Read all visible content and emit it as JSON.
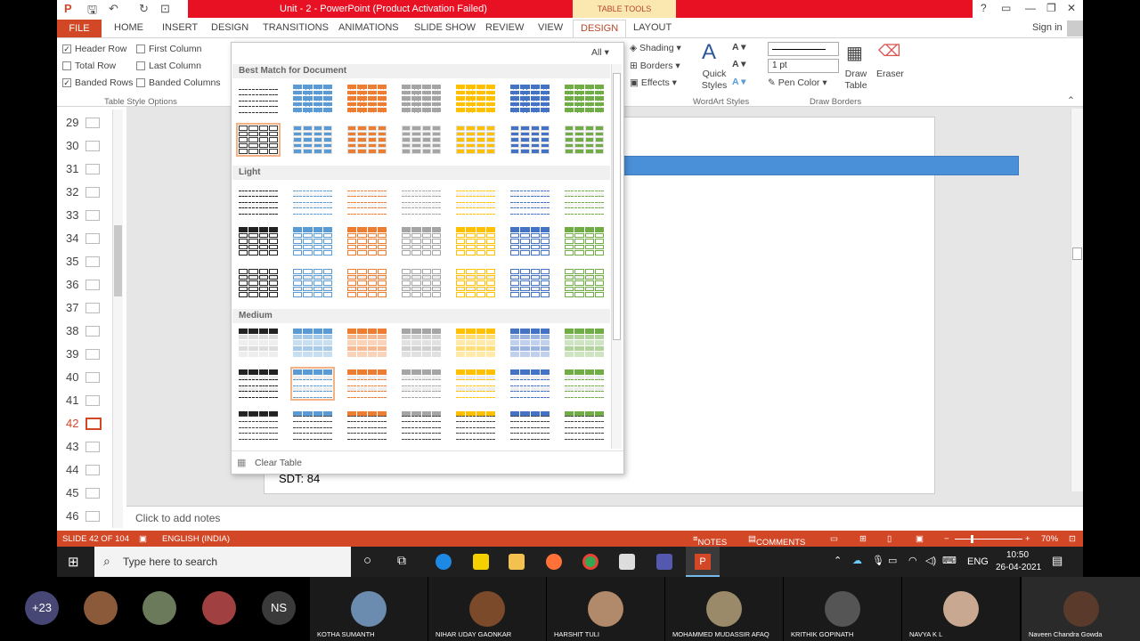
{
  "window": {
    "title": "Unit - 2 -  PowerPoint (Product Activation Failed)",
    "context_tab_group": "TABLE TOOLS",
    "sign_in": "Sign in",
    "help": "?",
    "controls": [
      "▭",
      "—",
      "❐",
      "✕"
    ]
  },
  "tabs": [
    "FILE",
    "HOME",
    "INSERT",
    "DESIGN",
    "TRANSITIONS",
    "ANIMATIONS",
    "SLIDE SHOW",
    "REVIEW",
    "VIEW",
    "DESIGN",
    "LAYOUT"
  ],
  "active_tab": "DESIGN",
  "table_style_options": {
    "header_row": "Header Row",
    "first_column": "First Column",
    "total_row": "Total Row",
    "last_column": "Last Column",
    "banded_rows": "Banded Rows",
    "banded_columns": "Banded Columns",
    "label": "Table Style Options",
    "checked": {
      "header_row": true,
      "first_column": false,
      "total_row": false,
      "last_column": false,
      "banded_rows": true,
      "banded_columns": false
    }
  },
  "ribbon": {
    "shading": "Shading",
    "borders": "Borders",
    "effects": "Effects",
    "quick_styles": "Quick Styles",
    "wordart_label": "WordArt Styles",
    "pen_weight": "1 pt",
    "pen_color": "Pen Color",
    "draw_table": "Draw Table",
    "eraser": "Eraser",
    "draw_borders_label": "Draw Borders"
  },
  "gallery": {
    "filter": "All",
    "sections": [
      "Best Match for Document",
      "Light",
      "Medium"
    ],
    "clear_table": "Clear Table",
    "colors": [
      "#7f7f7f",
      "#5b9bd5",
      "#ed7d31",
      "#a5a5a5",
      "#ffc000",
      "#4472c4",
      "#70ad47"
    ]
  },
  "slides": [
    {
      "num": "29"
    },
    {
      "num": "30"
    },
    {
      "num": "31"
    },
    {
      "num": "32"
    },
    {
      "num": "33"
    },
    {
      "num": "34"
    },
    {
      "num": "35"
    },
    {
      "num": "36"
    },
    {
      "num": "37"
    },
    {
      "num": "38"
    },
    {
      "num": "39"
    },
    {
      "num": "40"
    },
    {
      "num": "41"
    },
    {
      "num": "42"
    },
    {
      "num": "43"
    },
    {
      "num": "44"
    },
    {
      "num": "45"
    },
    {
      "num": "46"
    }
  ],
  "selected_slide": "42",
  "slide_text": "SDT: 84",
  "notes_placeholder": "Click to add notes",
  "status": {
    "slide": "SLIDE 42 OF 104",
    "language": "ENGLISH (INDIA)",
    "notes": "NOTES",
    "comments": "COMMENTS",
    "zoom": "70%"
  },
  "taskbar": {
    "search": "Type here to search",
    "time": "10:50",
    "date": "26-04-2021",
    "lang": "ENG"
  },
  "participants": {
    "overflow": "+23",
    "initials": "NS",
    "names": [
      "KOTHA SUMANTH",
      "NIHAR UDAY GAONKAR",
      "HARSHIT TULI",
      "MOHAMMED MUDASSIR AFAQ",
      "KRITHIK GOPINATH",
      "NAVYA K L",
      "Naveen Chandra Gowda"
    ]
  }
}
